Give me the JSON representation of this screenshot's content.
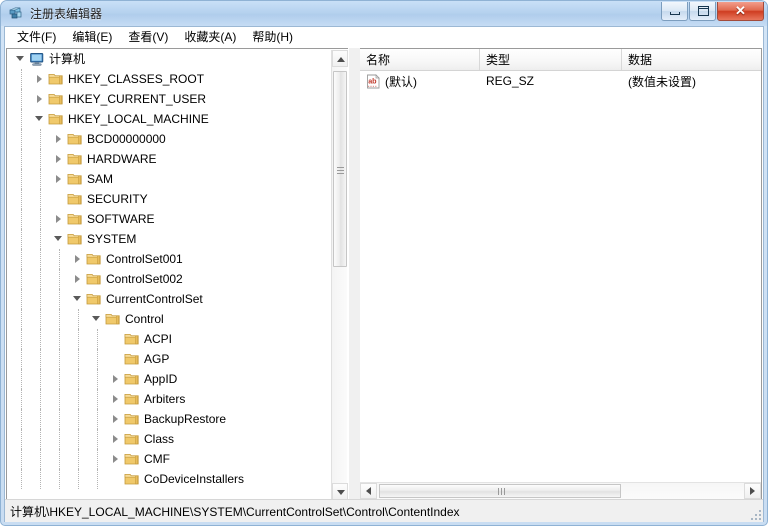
{
  "window": {
    "title": "注册表编辑器",
    "app_icon": "registry-editor-icon",
    "minimize_label": "最小化",
    "maximize_label": "最大化",
    "close_label": "关闭",
    "close_glyph": "✕"
  },
  "menubar": {
    "items": [
      {
        "text": "文件(F)",
        "label": "文件",
        "accel": "F"
      },
      {
        "text": "编辑(E)",
        "label": "编辑",
        "accel": "E"
      },
      {
        "text": "查看(V)",
        "label": "查看",
        "accel": "V"
      },
      {
        "text": "收藏夹(A)",
        "label": "收藏夹",
        "accel": "A"
      },
      {
        "text": "帮助(H)",
        "label": "帮助",
        "accel": "H"
      }
    ]
  },
  "tree": {
    "nodes": [
      {
        "label": "计算机",
        "depth": 0,
        "state": "expanded",
        "icon": "computer-icon"
      },
      {
        "label": "HKEY_CLASSES_ROOT",
        "depth": 1,
        "state": "collapsed",
        "icon": "folder-icon"
      },
      {
        "label": "HKEY_CURRENT_USER",
        "depth": 1,
        "state": "collapsed",
        "icon": "folder-icon"
      },
      {
        "label": "HKEY_LOCAL_MACHINE",
        "depth": 1,
        "state": "expanded",
        "icon": "folder-icon"
      },
      {
        "label": "BCD00000000",
        "depth": 2,
        "state": "collapsed",
        "icon": "folder-icon"
      },
      {
        "label": "HARDWARE",
        "depth": 2,
        "state": "collapsed",
        "icon": "folder-icon"
      },
      {
        "label": "SAM",
        "depth": 2,
        "state": "collapsed",
        "icon": "folder-icon"
      },
      {
        "label": "SECURITY",
        "depth": 2,
        "state": "leaf",
        "icon": "folder-icon"
      },
      {
        "label": "SOFTWARE",
        "depth": 2,
        "state": "collapsed",
        "icon": "folder-icon"
      },
      {
        "label": "SYSTEM",
        "depth": 2,
        "state": "expanded",
        "icon": "folder-icon"
      },
      {
        "label": "ControlSet001",
        "depth": 3,
        "state": "collapsed",
        "icon": "folder-icon"
      },
      {
        "label": "ControlSet002",
        "depth": 3,
        "state": "collapsed",
        "icon": "folder-icon"
      },
      {
        "label": "CurrentControlSet",
        "depth": 3,
        "state": "expanded",
        "icon": "folder-icon"
      },
      {
        "label": "Control",
        "depth": 4,
        "state": "expanded",
        "icon": "folder-icon"
      },
      {
        "label": "ACPI",
        "depth": 5,
        "state": "leaf",
        "icon": "folder-icon"
      },
      {
        "label": "AGP",
        "depth": 5,
        "state": "leaf",
        "icon": "folder-icon"
      },
      {
        "label": "AppID",
        "depth": 5,
        "state": "collapsed",
        "icon": "folder-icon"
      },
      {
        "label": "Arbiters",
        "depth": 5,
        "state": "collapsed",
        "icon": "folder-icon"
      },
      {
        "label": "BackupRestore",
        "depth": 5,
        "state": "collapsed",
        "icon": "folder-icon"
      },
      {
        "label": "Class",
        "depth": 5,
        "state": "collapsed",
        "icon": "folder-icon"
      },
      {
        "label": "CMF",
        "depth": 5,
        "state": "collapsed",
        "icon": "folder-icon"
      },
      {
        "label": "CoDeviceInstallers",
        "depth": 5,
        "state": "leaf",
        "icon": "folder-icon"
      }
    ]
  },
  "list": {
    "columns": [
      {
        "label": "名称",
        "width": 120
      },
      {
        "label": "类型",
        "width": 142
      },
      {
        "label": "数据",
        "width": 139
      }
    ],
    "rows": [
      {
        "icon": "string-value-icon",
        "name": "(默认)",
        "type": "REG_SZ",
        "data": "(数值未设置)"
      }
    ]
  },
  "statusbar": {
    "path": "计算机\\HKEY_LOCAL_MACHINE\\SYSTEM\\CurrentControlSet\\Control\\ContentIndex"
  },
  "scrollbars": {
    "tree_vertical": {
      "up_arrow": "▲",
      "down_arrow": "▼"
    },
    "list_horizontal": {
      "left_arrow": "◀",
      "right_arrow": "▶"
    }
  },
  "colors": {
    "titlebar_top": "#c9e0f7",
    "titlebar_bottom": "#c6dcf4",
    "frame": "#c9ddf2",
    "close_button": "#cf3d21",
    "folder": "#f3d07a",
    "pane_background": "#ffffff",
    "status_background": "#f0f0f0"
  }
}
